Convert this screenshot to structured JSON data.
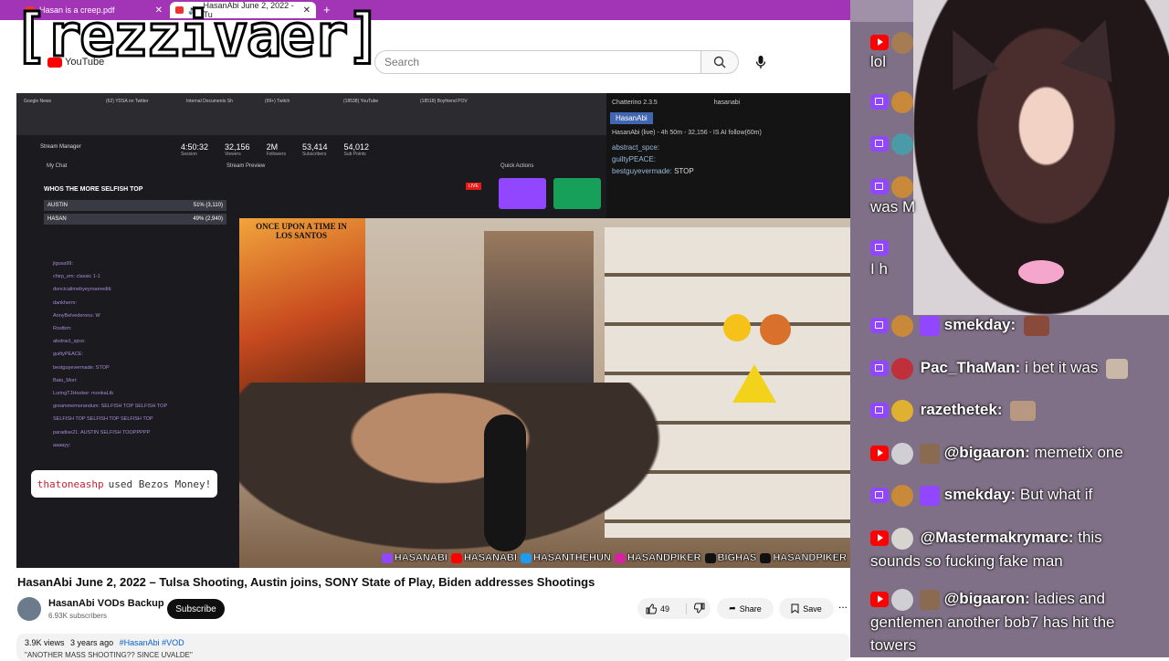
{
  "browser": {
    "tabs": [
      {
        "label": "Hasan is a creep.pdf"
      },
      {
        "label": "HasanAbi June 2, 2022 - Tu"
      }
    ],
    "new_tab": "+"
  },
  "overlay_name": "[rezzivaer]",
  "youtube": {
    "logo_text": "YouTube",
    "search_placeholder": "Search"
  },
  "stream": {
    "chrome_tabs": [
      "Google News",
      "(62) YDSA on Twitter",
      "Internal Documents Sh",
      "(99+) Twitch",
      "(18538) YouTube",
      "(18518) Boyfriend POV"
    ],
    "stats": [
      {
        "value": "4:50:32",
        "label": "Session"
      },
      {
        "value": "32,156",
        "label": "Viewers"
      },
      {
        "value": "2M",
        "label": "Followers"
      },
      {
        "value": "53,414",
        "label": "Subscribers"
      },
      {
        "value": "54,012",
        "label": "Sub Points"
      }
    ],
    "stream_manager": "Stream Manager",
    "my_chat": "My Chat",
    "stream_preview": "Stream Preview",
    "quick_actions": "Quick Actions",
    "live": "LIVE",
    "poll": {
      "question": "WHOS THE MORE SELFISH TOP",
      "options": [
        {
          "name": "AUSTIN",
          "pct": "51% (3,110)"
        },
        {
          "name": "HASAN",
          "pct": "49% (2,940)"
        }
      ]
    },
    "mini_chat": [
      "jlgusa99: ",
      "chirp_em: classic 1-1",
      "doncicalimebyeyrnamediti: ",
      "dankherm: ",
      "AnnyBelvederonu: W",
      "Rostbm: ",
      "abstract_spce: ",
      "guiltyPEACE: ",
      "bestguyevermade: STOP",
      "Bato_Mori: ",
      "LuringTJHooker: monkaLib",
      "greammemorandum: SELFISH TOP SELFISH TOP",
      "SELFISH TOP SELFISH TOP SELFISH TOP",
      "paradise21: AUSTIN SELFISH TOOPPPPP",
      "aaaayy: "
    ],
    "bezos_notice": {
      "user": "thatoneashp",
      "text": "used Bezos Money!"
    },
    "chatterino": {
      "title": "Chatterino 2.3.5",
      "channel": "hasanabi",
      "tab": "HasanAbi",
      "status": "HasanAbi (live) - 4h 50m - 32,156 - IS AI  follow(60m)",
      "messages": [
        {
          "user": "abstract_spce:",
          "text": ""
        },
        {
          "user": "guiltyPEACE:",
          "text": ""
        },
        {
          "user": "bestguyevermade:",
          "text": "STOP"
        }
      ]
    },
    "poster_text": "ONCE UPON A TIME IN LOS SANTOS",
    "socials": [
      "HASANABI",
      "HASANABI",
      "HASANTHEHUN",
      "HASANDPIKER",
      "BIGHAS",
      "HASANDPIKER"
    ]
  },
  "video": {
    "title": "HasanAbi June 2, 2022 – Tulsa Shooting, Austin joins, SONY State of Play, Biden addresses Shootings",
    "channel": "HasanAbi VODs Backup",
    "subscribers": "6.93K subscribers",
    "subscribe_label": "Subscribe",
    "likes": "49",
    "share_label": "Share",
    "save_label": "Save",
    "more_label": "...",
    "views": "3.9K views",
    "age": "3 years ago",
    "tags": "#HasanAbi #VOD",
    "desc_line": "\"ANOTHER MASS SHOOTING?? SINCE UVALDE\""
  },
  "overlay_chat": [
    {
      "platform": "yt",
      "user": "",
      "text": "lol"
    },
    {
      "platform": "tw",
      "user": "",
      "text": ""
    },
    {
      "platform": "tw",
      "user": "",
      "text": ""
    },
    {
      "platform": "tw",
      "user": "",
      "text": "was M"
    },
    {
      "platform": "tw",
      "user": "",
      "text": "I h"
    },
    {
      "platform": "tw",
      "user": "smekday:",
      "text": ""
    },
    {
      "platform": "tw",
      "user": "Pac_ThaMan:",
      "text": "i bet it was"
    },
    {
      "platform": "tw",
      "user": "razethetek:",
      "text": ""
    },
    {
      "platform": "yt",
      "user": "@bigaaron:",
      "text": "memetix one"
    },
    {
      "platform": "tw",
      "user": "smekday:",
      "text": "But what if"
    },
    {
      "platform": "yt",
      "user": "@Mastermakrymarc:",
      "text": "this sounds so fucking fake man"
    },
    {
      "platform": "yt",
      "user": "@bigaaron:",
      "text": "ladies and gentlemen another bob7 has hit the towers"
    }
  ],
  "colors": {
    "tabbar": "#a234b6",
    "twitch": "#9146ff",
    "youtube": "#ff0000"
  }
}
